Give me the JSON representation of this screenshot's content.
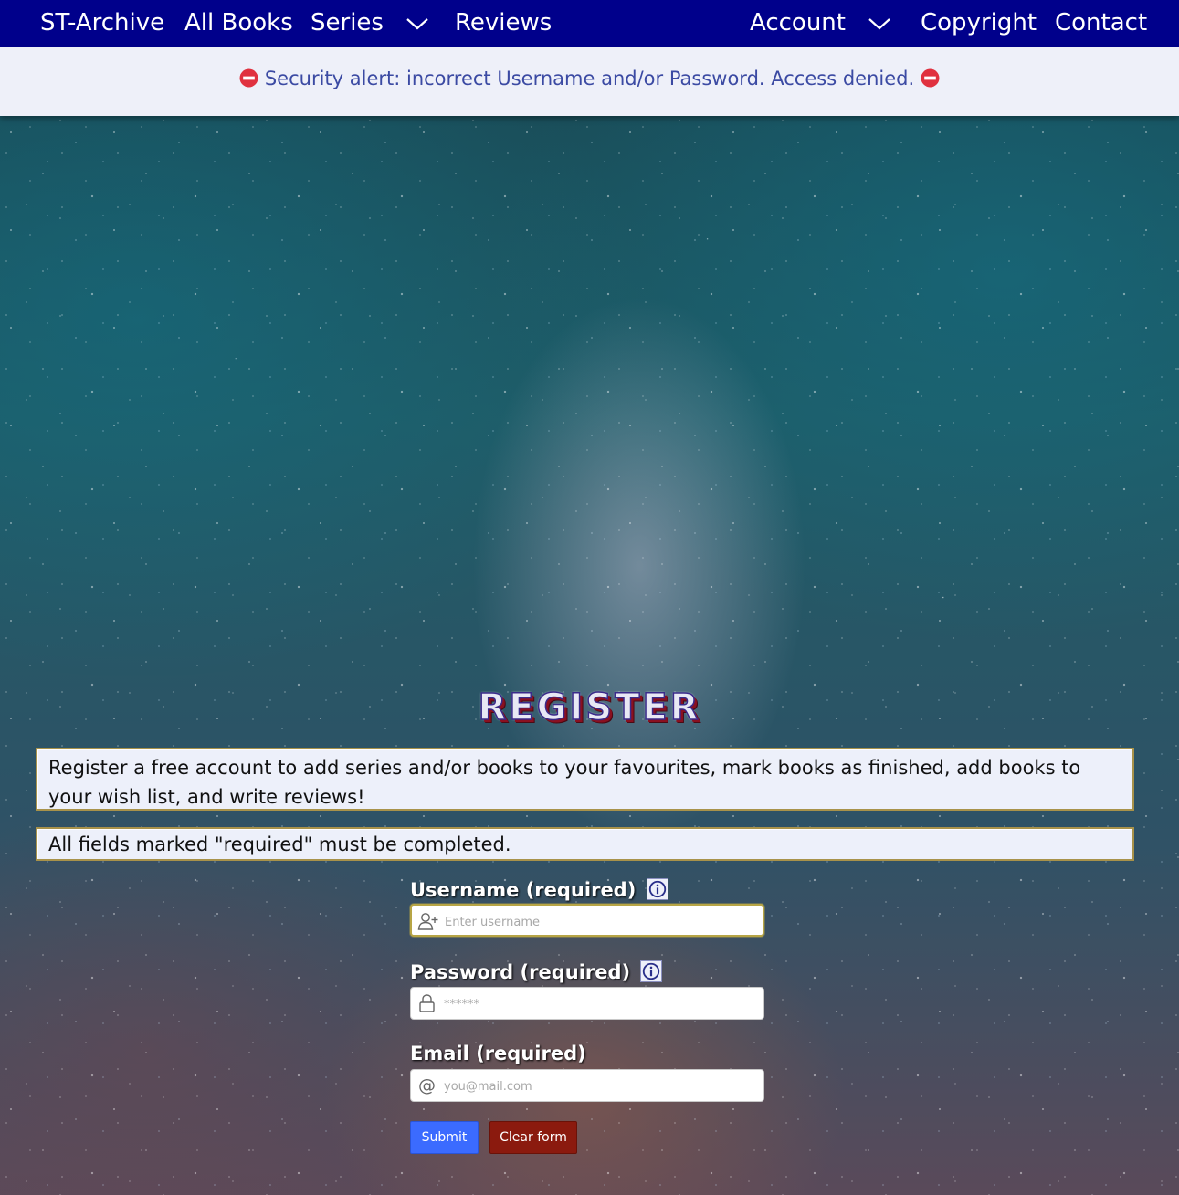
{
  "nav": {
    "brand": "ST-Archive",
    "all_books": "All Books",
    "series": "Series",
    "reviews": "Reviews",
    "account": "Account",
    "copyright": "Copyright",
    "contact": "Contact"
  },
  "alert": {
    "message": "Security alert: incorrect Username and/or Password. Access denied."
  },
  "page": {
    "title": "REGISTER",
    "intro": "Register a free account to add series and/or books to your favourites, mark books as finished, add books to your wish list, and write reviews!",
    "required_note": "All fields marked \"required\" must be completed."
  },
  "form": {
    "username": {
      "label": "Username (required)",
      "placeholder": "Enter username",
      "value": ""
    },
    "password": {
      "label": "Password (required)",
      "placeholder": "******",
      "value": ""
    },
    "email": {
      "label": "Email (required)",
      "placeholder": "you@mail.com",
      "value": ""
    },
    "submit_label": "Submit",
    "clear_label": "Clear form"
  },
  "icons": {
    "alert": "no-entry-icon",
    "username": "add-user-icon",
    "password": "lock-icon",
    "email": "at-sign-icon",
    "info": "info-icon",
    "dropdown": "chevron-down-icon"
  },
  "colors": {
    "navbar": "#00008b",
    "alert_bg": "#eef0f9",
    "alert_text": "#3b4aa3",
    "submit": "#3b6bff",
    "clear": "#8b1a0e",
    "box_border": "#a8924a"
  }
}
